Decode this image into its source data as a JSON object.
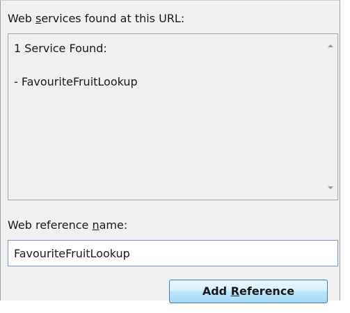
{
  "services_label": {
    "before": "Web ",
    "access_key": "s",
    "after": "ervices found at this URL:"
  },
  "services_box": {
    "line1": "1 Service Found:",
    "line2": "- FavouriteFruitLookup"
  },
  "scrollbar": {
    "up_icon": "arrow-up-icon",
    "down_icon": "arrow-down-icon"
  },
  "refname_label": {
    "before": "Web reference ",
    "access_key": "n",
    "after": "ame:"
  },
  "refname_input": {
    "value": "FavouriteFruitLookup"
  },
  "add_button": {
    "before": "Add ",
    "access_key": "R",
    "after": "eference"
  }
}
